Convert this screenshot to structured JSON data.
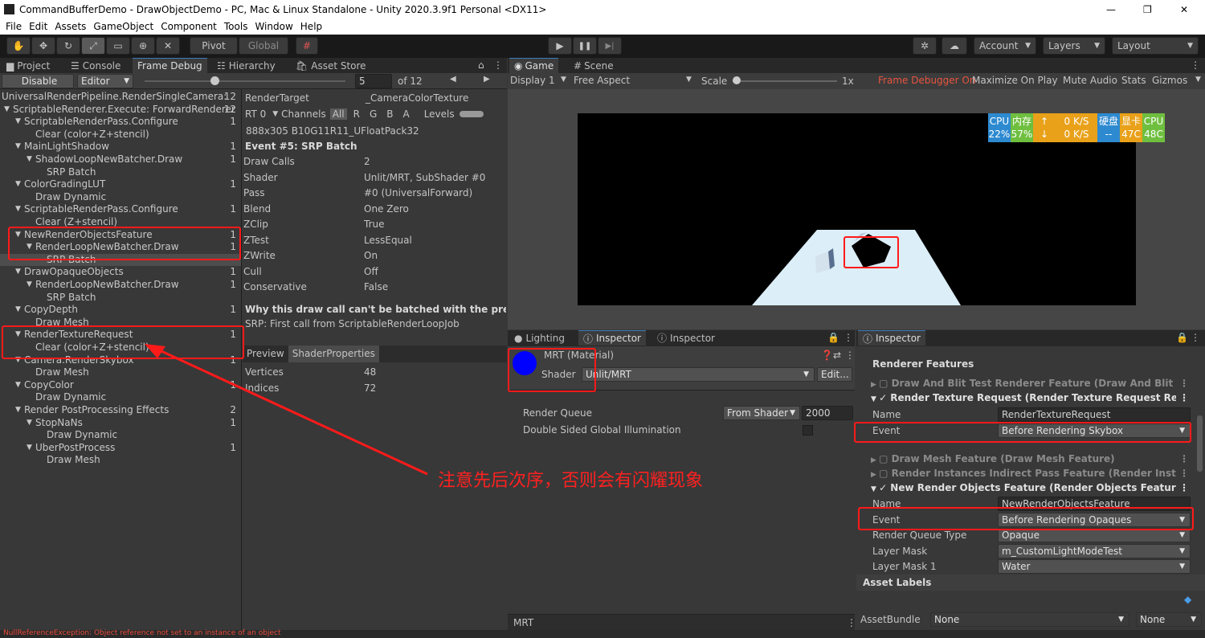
{
  "window": {
    "title": "CommandBufferDemo - DrawObjectDemo - PC, Mac & Linux Standalone - Unity 2020.3.9f1 Personal <DX11>",
    "min": "—",
    "max": "❐",
    "close": "✕"
  },
  "menu": [
    "File",
    "Edit",
    "Assets",
    "GameObject",
    "Component",
    "Tools",
    "Window",
    "Help"
  ],
  "toolbar": {
    "pivot": "Pivot",
    "global": "Global",
    "account": "Account",
    "layers": "Layers",
    "layout": "Layout",
    "play": "▶",
    "pause": "❚❚",
    "step": "▶|"
  },
  "left_tabs": [
    "Project",
    "Console",
    "Frame Debug",
    "Hierarchy",
    "Asset Store"
  ],
  "frame_debug": {
    "disable": "Disable",
    "editor": "Editor",
    "event_index": "5",
    "of_total": "of 12"
  },
  "tree": [
    {
      "label": "UniversalRenderPipeline.RenderSingleCamera:",
      "count": "12",
      "indent": 0,
      "arrow": false
    },
    {
      "label": "ScriptableRenderer.Execute: ForwardRenderer",
      "count": "12",
      "indent": 1,
      "arrow": true
    },
    {
      "label": "ScriptableRenderPass.Configure",
      "count": "1",
      "indent": 2,
      "arrow": true
    },
    {
      "label": "Clear (color+Z+stencil)",
      "count": "",
      "indent": 3,
      "arrow": false
    },
    {
      "label": "MainLightShadow",
      "count": "1",
      "indent": 2,
      "arrow": true
    },
    {
      "label": "ShadowLoopNewBatcher.Draw",
      "count": "1",
      "indent": 3,
      "arrow": true
    },
    {
      "label": "SRP Batch",
      "count": "",
      "indent": 4,
      "arrow": false
    },
    {
      "label": "ColorGradingLUT",
      "count": "1",
      "indent": 2,
      "arrow": true
    },
    {
      "label": "Draw Dynamic",
      "count": "",
      "indent": 3,
      "arrow": false
    },
    {
      "label": "ScriptableRenderPass.Configure",
      "count": "1",
      "indent": 2,
      "arrow": true
    },
    {
      "label": "Clear (Z+stencil)",
      "count": "",
      "indent": 3,
      "arrow": false
    },
    {
      "label": "NewRenderObjectsFeature",
      "count": "1",
      "indent": 2,
      "arrow": true
    },
    {
      "label": "RenderLoopNewBatcher.Draw",
      "count": "1",
      "indent": 3,
      "arrow": true
    },
    {
      "label": "SRP Batch",
      "count": "",
      "indent": 4,
      "arrow": false,
      "selected": true
    },
    {
      "label": "DrawOpaqueObjects",
      "count": "1",
      "indent": 2,
      "arrow": true
    },
    {
      "label": "RenderLoopNewBatcher.Draw",
      "count": "1",
      "indent": 3,
      "arrow": true
    },
    {
      "label": "SRP Batch",
      "count": "",
      "indent": 4,
      "arrow": false
    },
    {
      "label": "CopyDepth",
      "count": "1",
      "indent": 2,
      "arrow": true
    },
    {
      "label": "Draw Mesh",
      "count": "",
      "indent": 3,
      "arrow": false
    },
    {
      "label": "RenderTextureRequest",
      "count": "1",
      "indent": 2,
      "arrow": true
    },
    {
      "label": "Clear (color+Z+stencil)",
      "count": "",
      "indent": 3,
      "arrow": false
    },
    {
      "label": "Camera.RenderSkybox",
      "count": "1",
      "indent": 2,
      "arrow": true
    },
    {
      "label": "Draw Mesh",
      "count": "",
      "indent": 3,
      "arrow": false
    },
    {
      "label": "CopyColor",
      "count": "1",
      "indent": 2,
      "arrow": true
    },
    {
      "label": "Draw Dynamic",
      "count": "",
      "indent": 3,
      "arrow": false
    },
    {
      "label": "Render PostProcessing Effects",
      "count": "2",
      "indent": 2,
      "arrow": true
    },
    {
      "label": "StopNaNs",
      "count": "1",
      "indent": 3,
      "arrow": true
    },
    {
      "label": "Draw Dynamic",
      "count": "",
      "indent": 4,
      "arrow": false
    },
    {
      "label": "UberPostProcess",
      "count": "1",
      "indent": 3,
      "arrow": true
    },
    {
      "label": "Draw Mesh",
      "count": "",
      "indent": 4,
      "arrow": false
    }
  ],
  "details": {
    "render_target_label": "RenderTarget",
    "render_target": "_CameraColorTexture",
    "rt": "RT 0",
    "channels": "Channels",
    "ch_all": "All",
    "ch_r": "R",
    "ch_g": "G",
    "ch_b": "B",
    "ch_a": "A",
    "levels": "Levels",
    "format": "888x305 B10G11R11_UFloatPack32",
    "event": "Event #5: SRP Batch",
    "props": [
      {
        "k": "Draw Calls",
        "v": "2"
      },
      {
        "k": "Shader",
        "v": "Unlit/MRT, SubShader #0"
      },
      {
        "k": "Pass",
        "v": "#0 (UniversalForward)"
      },
      {
        "k": "Blend",
        "v": "One Zero"
      },
      {
        "k": "ZClip",
        "v": "True"
      },
      {
        "k": "ZTest",
        "v": "LessEqual"
      },
      {
        "k": "ZWrite",
        "v": "On"
      },
      {
        "k": "Cull",
        "v": "Off"
      },
      {
        "k": "Conservative",
        "v": "False"
      }
    ],
    "why": "Why this draw call can't be batched with the previous o",
    "srp": "SRP: First call from ScriptableRenderLoopJob",
    "preview_tab": "Preview",
    "shaderprops_tab": "ShaderProperties",
    "vertices_label": "Vertices",
    "vertices": "48",
    "indices_label": "Indices",
    "indices": "72"
  },
  "game": {
    "tab_game": "Game",
    "tab_scene": "Scene",
    "display": "Display 1",
    "aspect": "Free Aspect",
    "scale": "Scale",
    "scale_val": "1x",
    "fd_on": "Frame Debugger On",
    "max_on_play": "Maximize On Play",
    "mute": "Mute Audio",
    "stats": "Stats",
    "gizmos": "Gizmos",
    "monitor": [
      {
        "top": "CPU",
        "bottom": "22%",
        "color": "#2d8ad0"
      },
      {
        "top": "内存",
        "bottom": "57%",
        "color": "#6fbf3f"
      },
      {
        "top": "↑",
        "bottom": "↓",
        "color": "#e9a11a"
      },
      {
        "top": "0 K/S",
        "bottom": "0 K/S",
        "color": "#e9a11a"
      },
      {
        "top": "硬盘",
        "bottom": "--",
        "color": "#2d8ad0"
      },
      {
        "top": "显卡",
        "bottom": "47C",
        "color": "#e9a11a"
      },
      {
        "top": "CPU",
        "bottom": "48C",
        "color": "#6fbf3f"
      }
    ]
  },
  "mid": {
    "tabs": [
      "Lighting",
      "Inspector",
      "Inspector"
    ],
    "material_name": "MRT (Material)",
    "shader_label": "Shader",
    "shader_value": "Unlit/MRT",
    "edit": "Edit...",
    "render_queue_label": "Render Queue",
    "render_queue_mode": "From Shader",
    "render_queue_value": "2000",
    "dsgi": "Double Sided Global Illumination",
    "footer": "MRT",
    "colors": {
      "swatch": "#0000ff"
    }
  },
  "right": {
    "tab": "Inspector",
    "section": "Renderer Features",
    "features": [
      {
        "label": "Draw And Blit Test Renderer Feature (Draw And Blit Tes",
        "checked": false,
        "expanded": false
      },
      {
        "label": "Render Texture Request (Render Texture Request Rend",
        "checked": true,
        "expanded": true
      }
    ],
    "rtr_name_label": "Name",
    "rtr_name": "RenderTextureRequest",
    "rtr_event_label": "Event",
    "rtr_event": "Before Rendering Skybox",
    "features2": [
      {
        "label": "Draw Mesh Feature (Draw Mesh Feature)",
        "checked": false,
        "expanded": false
      },
      {
        "label": "Render Instances Indirect Pass Feature (Render Instanc",
        "checked": false,
        "expanded": false
      },
      {
        "label": "New Render Objects Feature (Render Objects Feature)",
        "checked": true,
        "expanded": true
      }
    ],
    "nro_name_label": "Name",
    "nro_name": "NewRenderObjectsFeature",
    "nro_event_label": "Event",
    "nro_event": "Before Rendering Opaques",
    "rqt_label": "Render Queue Type",
    "rqt": "Opaque",
    "lm_label": "Layer Mask",
    "lm": "m_CustomLightModeTest",
    "lm1_label": "Layer Mask 1",
    "lm1": "Water",
    "asset_labels": "Asset Labels",
    "assetbundle_label": "AssetBundle",
    "assetbundle": "None",
    "variant": "None"
  },
  "annotation": {
    "text": "注意先后次序，否则会有闪耀现象",
    "color": "#ff2020"
  },
  "status": {
    "text": "NullReferenceException: Object reference not set to an instance of an object"
  }
}
